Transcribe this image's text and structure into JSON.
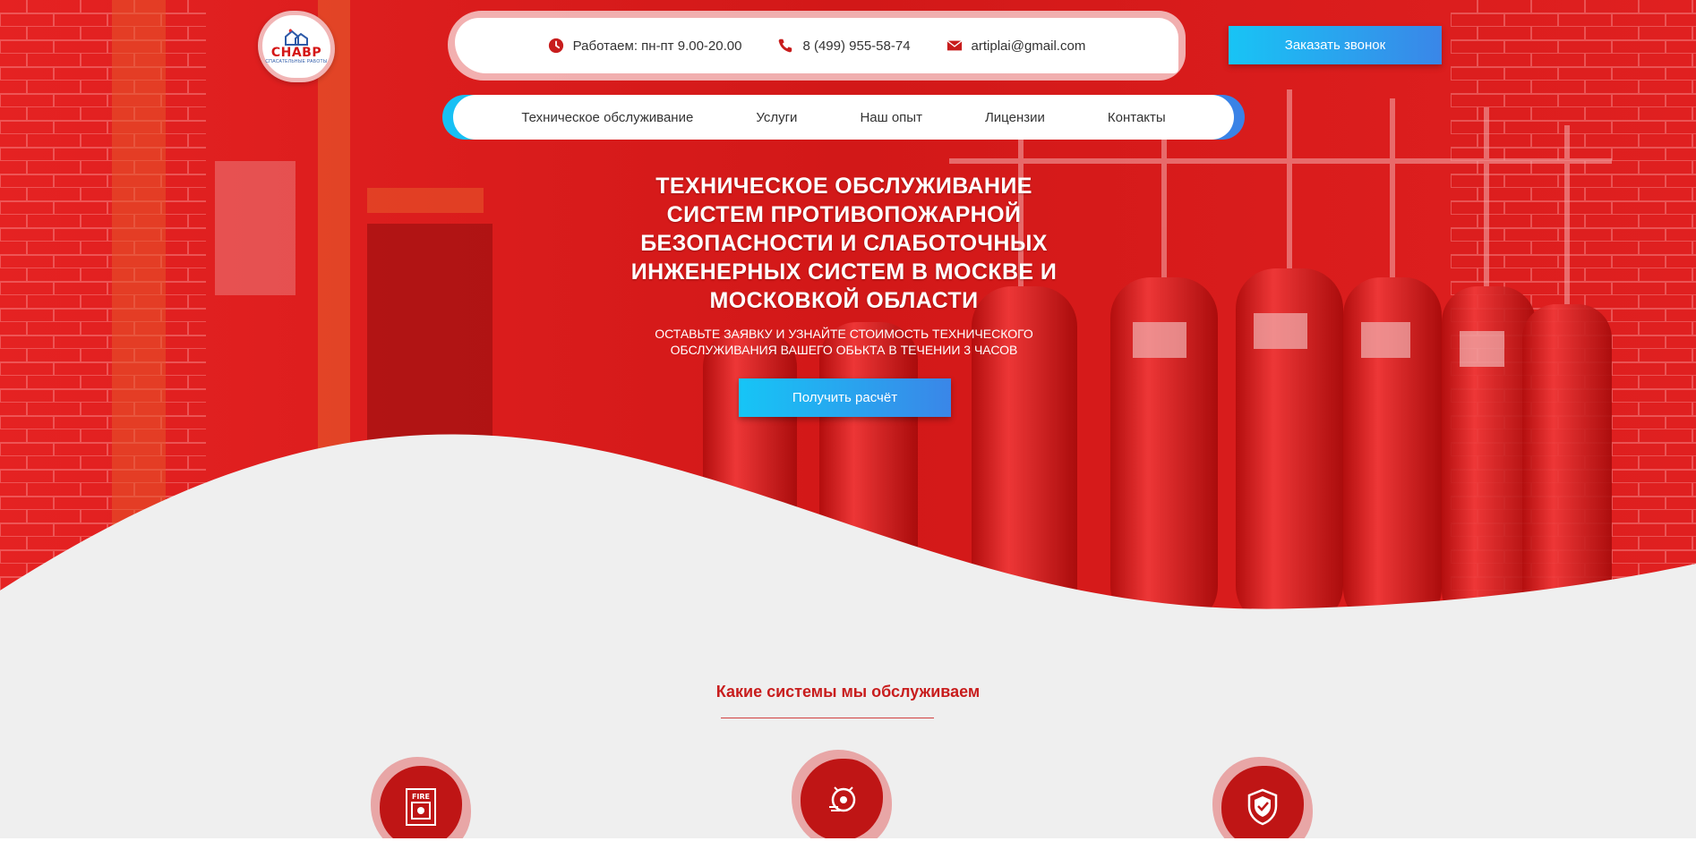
{
  "logo": {
    "name": "СНАВР",
    "subtitle": "СПАСАТЕЛЬНЫЕ РАБОТЫ"
  },
  "contacts": {
    "hours": "Работаем: пн-пт 9.00-20.00",
    "phone": "8 (499) 955-58-74",
    "email": "artiplai@gmail.com",
    "icons": [
      "clock-icon",
      "phone-icon",
      "mail-icon"
    ]
  },
  "order_button": "Заказать звонок",
  "nav": {
    "items": [
      {
        "label": "Техническое обслуживание"
      },
      {
        "label": "Услуги"
      },
      {
        "label": "Наш опыт"
      },
      {
        "label": "Лицензии"
      },
      {
        "label": "Контакты"
      }
    ]
  },
  "hero": {
    "title_lines": [
      "ТЕХНИЧЕСКОЕ ОБСЛУЖИВАНИЕ",
      "СИСТЕМ ПРОТИВОПОЖАРНОЙ",
      "БЕЗОПАСНОСТИ И СЛАБОТОЧНЫХ",
      "ИНЖЕНЕРНЫХ СИСТЕМ В МОСКВЕ И",
      "МОСКОВКОЙ ОБЛАСТИ"
    ],
    "subtitle_lines": [
      "ОСТАВЬТЕ ЗАЯВКУ И УЗНАЙТЕ СТОИМОСТЬ ТЕХНИЧЕСКОГО",
      "ОБСЛУЖИВАНИЯ ВАШЕГО ОБЬКТА В ТЕЧЕНИИ 3 ЧАСОВ"
    ],
    "cta": "Получить расчёт"
  },
  "systems": {
    "title": "Какие системы мы обслуживаем",
    "items": [
      {
        "icon": "fire-alarm-icon",
        "label": "FIRE"
      },
      {
        "icon": "alarm-bell-icon"
      },
      {
        "icon": "security-shield-icon"
      }
    ]
  },
  "colors": {
    "red": "#c81d1d",
    "accent_gradient_start": "#18c4f5",
    "accent_gradient_end": "#3a86e8",
    "bg": "#efefef"
  }
}
